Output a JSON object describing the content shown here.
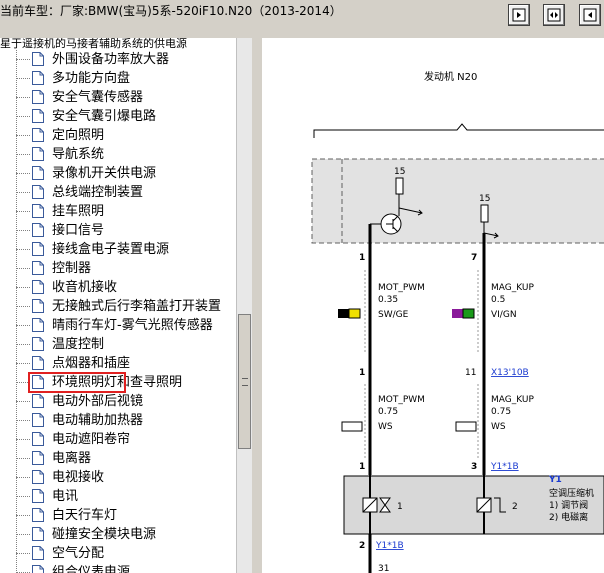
{
  "window": {
    "title": "当前车型：厂家:BMW(宝马)5系-520iF10.N20（2013-2014）"
  },
  "toolbar": {
    "buttons": [
      {
        "name": "prev-page-button"
      },
      {
        "name": "fit-width-button"
      },
      {
        "name": "next-page-button"
      }
    ]
  },
  "tree": {
    "header_cut": "星于遥接机的马接者辅助系统的供电源",
    "items": [
      "外围设备功率放大器",
      "多功能方向盘",
      "安全气囊传感器",
      "安全气囊引爆电路",
      "定向照明",
      "导航系统",
      "录像机开关供电源",
      "总线端控制装置",
      "挂车照明",
      "接口信号",
      "接线盒电子装置电源",
      "控制器",
      "收音机接收",
      "无接触式后行李箱盖打开装置",
      "晴雨行车灯-雾气光照传感器",
      "温度控制",
      "点烟器和插座",
      "环境照明灯和查寻照明",
      "电动外部后视镜",
      "电动辅助加热器",
      "电动遮阳卷帘",
      "电离器",
      "电视接收",
      "电讯",
      "白天行车灯",
      "碰撞安全模块电源",
      "空气分配",
      "组合仪表电源"
    ],
    "selected_index": 15
  },
  "diagram": {
    "header": "发动机 N20",
    "fuse_left": "15",
    "fuse_right": "15",
    "pin_top_left": "1",
    "pin_top_right": "7",
    "wire1_name": "MOT_PWM",
    "wire1_size": "0.35",
    "wire1_color": "SW/GE",
    "wire2_name": "MAG_KUP",
    "wire2_size": "0.5",
    "wire2_color": "VI/GN",
    "conn_pin_left": "1",
    "conn_pin_right": "11",
    "conn_ref": "X13'10B",
    "wire3_name": "MOT_PWM",
    "wire3_size": "0.75",
    "wire3_color": "WS",
    "wire4_name": "MAG_KUP",
    "wire4_size": "0.75",
    "wire4_color": "WS",
    "comp_pin_left": "1",
    "comp_pin_right": "3",
    "comp_ref_top": "Y1*1B",
    "comp_id": "Y1",
    "comp_desc": "空调压缩机",
    "comp_note1": "1)  调节阀",
    "comp_note2": "2)  电磁离",
    "inner_pin1": "1",
    "inner_pin2": "2",
    "bottom_pin": "2",
    "bottom_ref": "Y1*1B",
    "cut_number": "31",
    "swatch_colors": {
      "sw": "#000000",
      "ge": "#f0e000",
      "vi": "#8a1a9a",
      "gn": "#1a9a1a"
    }
  }
}
